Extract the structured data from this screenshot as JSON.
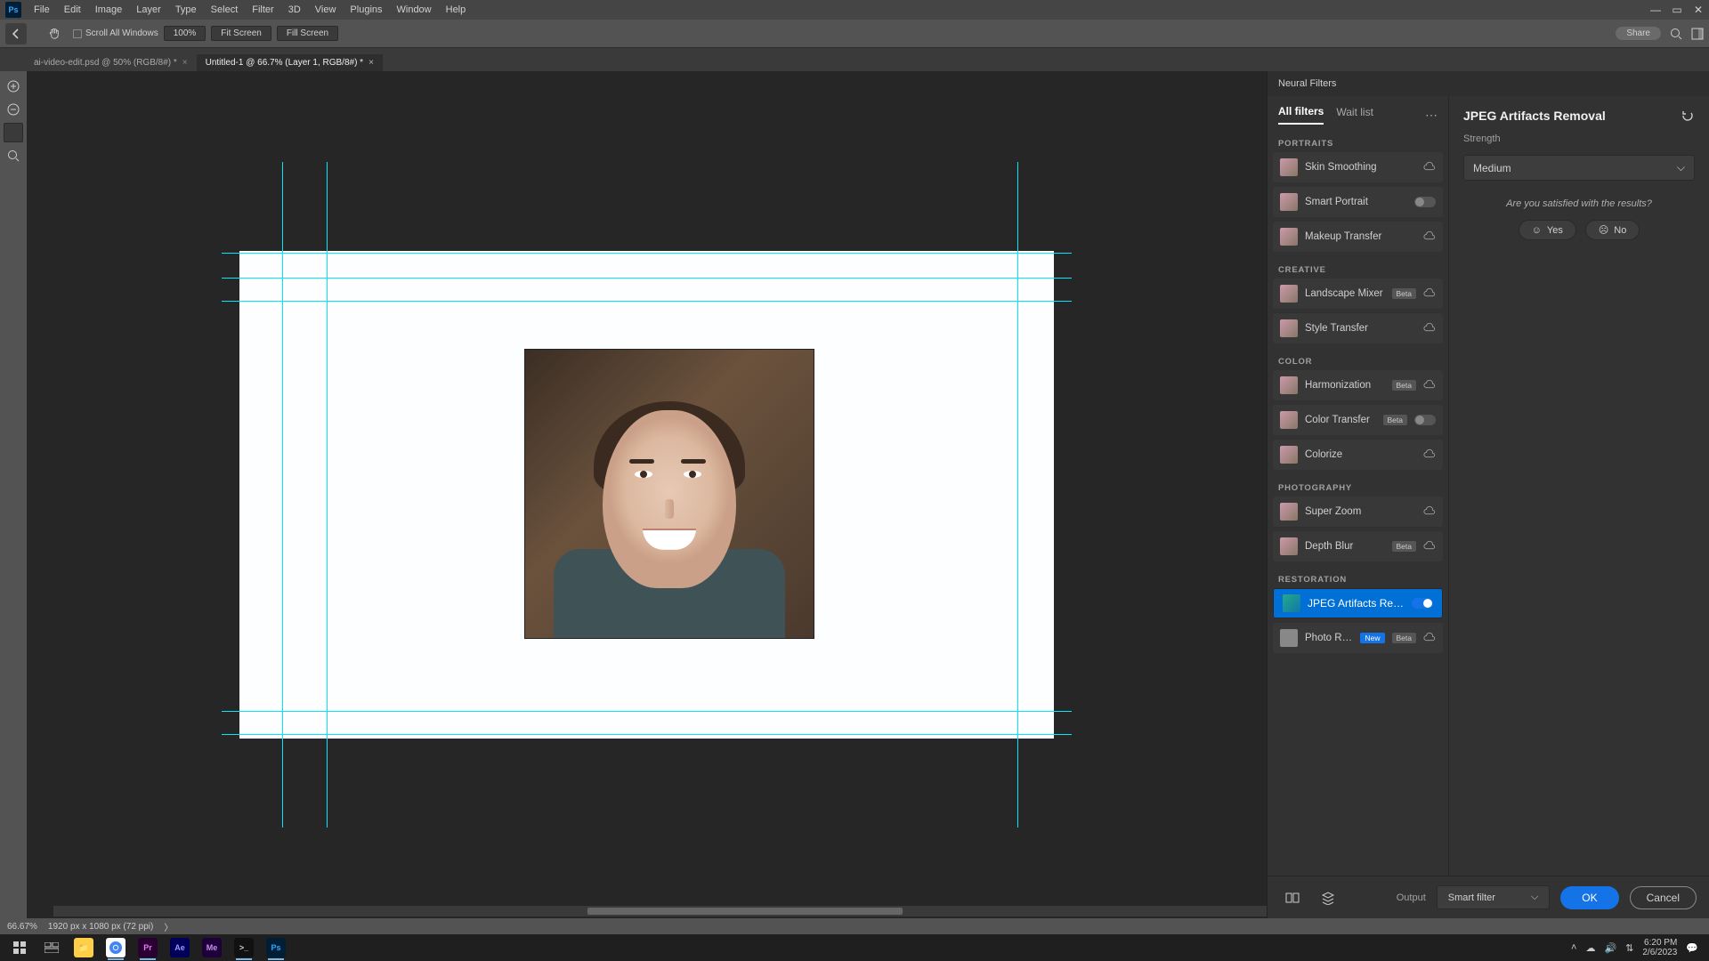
{
  "menu": [
    "File",
    "Edit",
    "Image",
    "Layer",
    "Type",
    "Select",
    "Filter",
    "3D",
    "View",
    "Plugins",
    "Window",
    "Help"
  ],
  "options": {
    "scroll_all": "Scroll All Windows",
    "z100": "100%",
    "fit": "Fit Screen",
    "fill": "Fill Screen",
    "share": "Share"
  },
  "doc_tabs": [
    {
      "label": "ai-video-edit.psd @ 50% (RGB/8#) *",
      "active": false
    },
    {
      "label": "Untitled-1 @ 66.7% (Layer 1, RGB/8#) *",
      "active": true
    }
  ],
  "status": {
    "zoom": "66.67%",
    "dims": "1920 px x 1080 px (72 ppi)"
  },
  "panel": {
    "title": "Neural Filters",
    "tabs": {
      "all": "All filters",
      "wait": "Wait list"
    },
    "cats": {
      "portraits": "PORTRAITS",
      "creative": "CREATIVE",
      "color": "COLOR",
      "photography": "PHOTOGRAPHY",
      "restoration": "RESTORATION"
    },
    "filters": {
      "skin": "Skin Smoothing",
      "smart": "Smart Portrait",
      "makeup": "Makeup Transfer",
      "landscape": "Landscape Mixer",
      "style": "Style Transfer",
      "harm": "Harmonization",
      "ctrans": "Color Transfer",
      "colorize": "Colorize",
      "zoom": "Super Zoom",
      "depth": "Depth Blur",
      "jpeg": "JPEG Artifacts Removal",
      "photo": "Photo Res..."
    },
    "badges": {
      "beta": "Beta",
      "new": "New"
    }
  },
  "params": {
    "title": "JPEG Artifacts Removal",
    "strength_label": "Strength",
    "strength_value": "Medium",
    "sat": "Are you satisfied with the results?",
    "yes": "Yes",
    "no": "No"
  },
  "footer": {
    "output_label": "Output",
    "output_value": "Smart filter",
    "ok": "OK",
    "cancel": "Cancel"
  },
  "tray": {
    "time": "6:20 PM",
    "date": "2/6/2023"
  }
}
